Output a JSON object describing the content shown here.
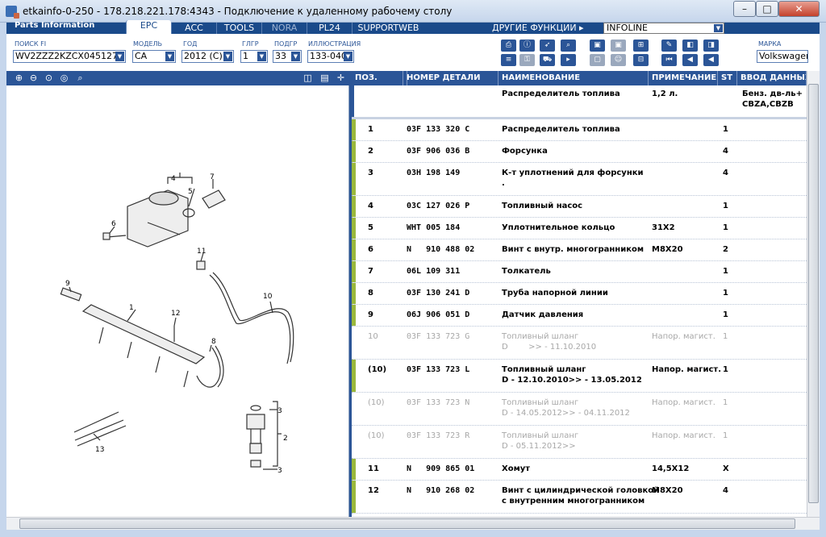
{
  "window": {
    "title": "etkainfo-0-250 - 178.218.221.178:4343 - Подключение к удаленному рабочему столу"
  },
  "app": {
    "brand": "Parts Information",
    "tabs": [
      "EPC",
      "ACC",
      "TOOLS",
      "NORA",
      "PL24",
      "SUPPORTWEB"
    ],
    "other_functions": "ДРУГИЕ ФУНКЦИИ ▸",
    "infoline": "INFOLINE"
  },
  "filters": {
    "search_label": "ПОИСК FI",
    "search_value": "WV2ZZZ2KZCX045127",
    "model_label": "МОДЕЛЬ",
    "model_value": "CA",
    "year_label": "ГОД",
    "year_value": "2012 (C)",
    "hg_label": "ГЛГР",
    "hg_value": "1",
    "sg_label": "ПОДГР",
    "sg_value": "33",
    "illus_label": "ИЛЛЮСТРАЦИЯ",
    "illus_value": "133-040",
    "brand_label": "МАРКА",
    "brand_value": "Volkswagen"
  },
  "table": {
    "headers": [
      "ПОЗ.",
      "",
      "НОМЕР ДЕТАЛИ",
      "НАИМЕНОВАНИЕ",
      "ПРИМЕЧАНИЕ",
      "ST",
      "ВВОД ДАННЫХ"
    ],
    "header_row": {
      "name": "Распределитель топлива",
      "note": "1,2 л.",
      "data": "Бенз. дв-ль+\nCBZA,CBZB"
    },
    "rows": [
      {
        "pos": "1",
        "part": "03F 133 320 C",
        "name": "Распределитель топлива",
        "note": "",
        "st": "1",
        "grey": false
      },
      {
        "pos": "2",
        "part": "03F 906 036 B",
        "name": "Форсунка",
        "note": "",
        "st": "4",
        "grey": false
      },
      {
        "pos": "3",
        "part": "03H 198 149",
        "name": "К-т уплотнений для форсунки\n.",
        "note": "",
        "st": "4",
        "grey": false
      },
      {
        "pos": "4",
        "part": "03C 127 026 P",
        "name": "Топливный насос",
        "note": "",
        "st": "1",
        "grey": false
      },
      {
        "pos": "5",
        "part": "WHT 005 184",
        "name": "Уплотнительное кольцо",
        "note": "31X2",
        "st": "1",
        "grey": false
      },
      {
        "pos": "6",
        "part": "N   910 488 02",
        "name": "Винт с внутр. многогранником",
        "note": "M8X20",
        "st": "2",
        "grey": false
      },
      {
        "pos": "7",
        "part": "06L 109 311",
        "name": "Толкатель",
        "note": "",
        "st": "1",
        "grey": false
      },
      {
        "pos": "8",
        "part": "03F 130 241 D",
        "name": "Труба напорной линии",
        "note": "",
        "st": "1",
        "grey": false
      },
      {
        "pos": "9",
        "part": "06J 906 051 D",
        "name": "Датчик давления",
        "note": "",
        "st": "1",
        "grey": false
      },
      {
        "pos": "10",
        "part": "03F 133 723 G",
        "name": "Топливный шланг\nD        >> - 11.10.2010",
        "note": "Напор. магист.",
        "st": "1",
        "grey": true
      },
      {
        "pos": "(10)",
        "part": "03F 133 723 L",
        "name": "Топливный шланг\nD - 12.10.2010>> - 13.05.2012",
        "note": "Напор. магист.",
        "st": "1",
        "grey": false
      },
      {
        "pos": "(10)",
        "part": "03F 133 723 N",
        "name": "Топливный шланг\nD - 14.05.2012>> - 04.11.2012",
        "note": "Напор. магист.",
        "st": "1",
        "grey": true
      },
      {
        "pos": "(10)",
        "part": "03F 133 723 R",
        "name": "Топливный шланг\nD - 05.11.2012>>",
        "note": "Напор. магист.",
        "st": "1",
        "grey": true
      },
      {
        "pos": "11",
        "part": "N   909 865 01",
        "name": "Хомут",
        "note": "14,5X12",
        "st": "X",
        "grey": false
      },
      {
        "pos": "12",
        "part": "N   910 268 02",
        "name": "Винт с цилиндрической головкой\nс внутренним многогранником",
        "note": "M8X20",
        "st": "4",
        "grey": false
      }
    ]
  },
  "diagram": {
    "callouts": [
      "1",
      "2",
      "3",
      "3",
      "4",
      "5",
      "6",
      "7",
      "8",
      "9",
      "10",
      "11",
      "12",
      "13"
    ]
  }
}
